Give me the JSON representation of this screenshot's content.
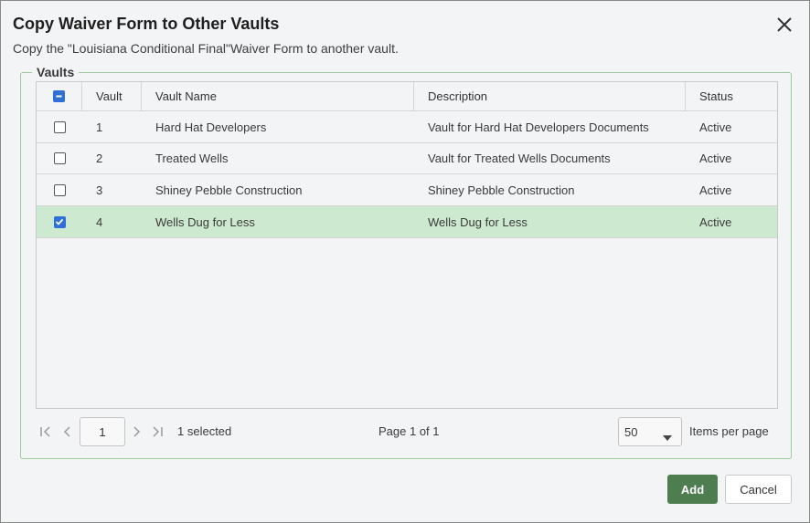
{
  "dialog": {
    "title": "Copy Waiver Form to Other Vaults",
    "subtitle": "Copy the \"Louisiana Conditional Final\"Waiver Form to another vault.",
    "close_icon": "close-icon"
  },
  "vaults": {
    "legend": "Vaults",
    "columns": [
      "",
      "Vault",
      "Vault Name",
      "Description",
      "Status"
    ],
    "header_checkbox_state": "indeterminate",
    "rows": [
      {
        "checked": false,
        "vault": "1",
        "name": "Hard Hat Developers",
        "description": "Vault for Hard Hat Developers Documents",
        "status": "Active"
      },
      {
        "checked": false,
        "vault": "2",
        "name": "Treated Wells",
        "description": "Vault for Treated Wells Documents",
        "status": "Active"
      },
      {
        "checked": false,
        "vault": "3",
        "name": "Shiney Pebble Construction",
        "description": "Shiney Pebble Construction",
        "status": "Active"
      },
      {
        "checked": true,
        "vault": "4",
        "name": "Wells Dug for Less",
        "description": "Wells Dug for Less",
        "status": "Active"
      }
    ]
  },
  "pager": {
    "page_value": "1",
    "selected_text": "1 selected",
    "page_of": "Page 1 of 1",
    "per_page_value": "50",
    "per_page_label": "Items per page"
  },
  "buttons": {
    "add": "Add",
    "cancel": "Cancel"
  },
  "colors": {
    "accent": "#4e7d4f",
    "selected_row": "#cde9cf",
    "checkbox": "#2f6fd6"
  }
}
